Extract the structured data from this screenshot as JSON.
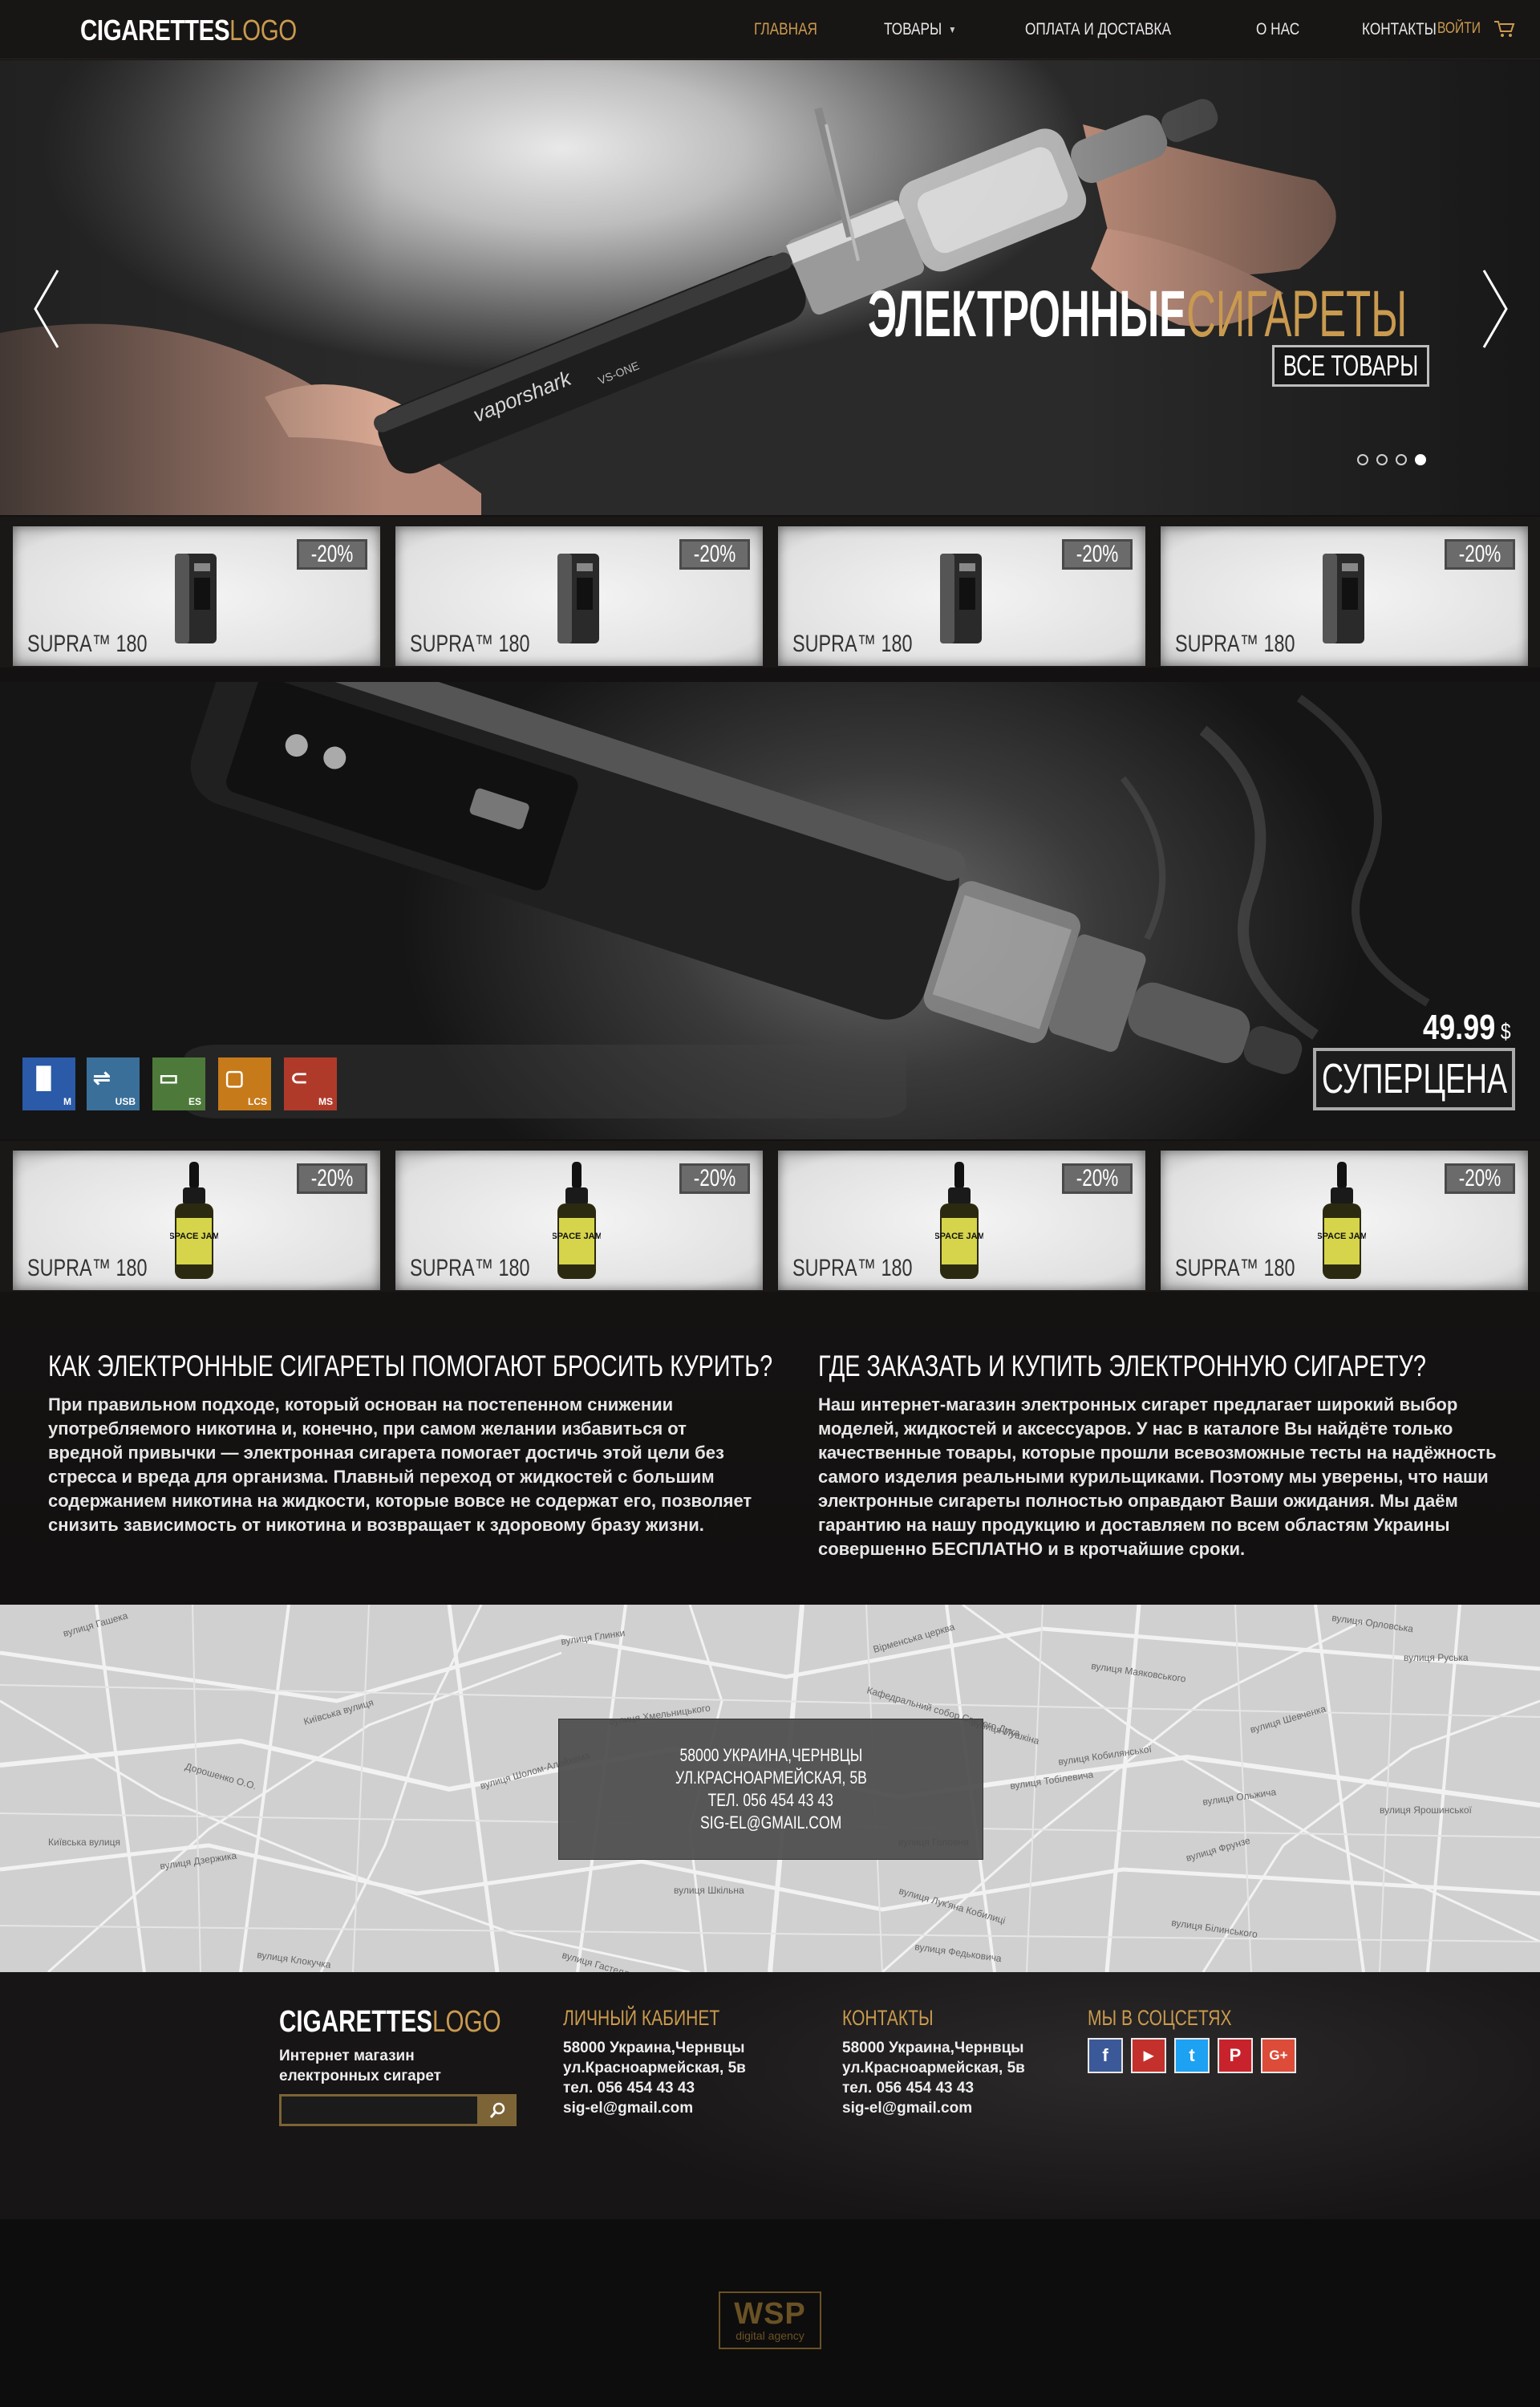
{
  "logo": {
    "part1": "CIGARETTES",
    "part2": "LOGO"
  },
  "nav": {
    "home": "ГЛАВНАЯ",
    "products": "ТОВАРЫ",
    "payment": "ОПЛАТА И ДОСТАВКА",
    "about": "О НАС",
    "contacts": "КОНТАКТЫ"
  },
  "cart": {
    "label": "ВОЙТИ",
    "icon": "cart-icon"
  },
  "hero": {
    "title_part1": "ЭЛЕКТРОННЫЕ",
    "title_part2": "СИГАРЕТЫ",
    "button": "ВСЕ ТОВАРЫ",
    "slides_total": 4,
    "active_slide": 4,
    "device_text": "vaporshark VS-ONE"
  },
  "products_row1": [
    {
      "name": "SUPRA™ 180",
      "badge": "-20%"
    },
    {
      "name": "SUPRA™ 180",
      "badge": "-20%"
    },
    {
      "name": "SUPRA™ 180",
      "badge": "-20%"
    },
    {
      "name": "SUPRA™ 180",
      "badge": "-20%"
    }
  ],
  "promo": {
    "price": "49.99",
    "currency": "$",
    "button": "СУПЕРЦЕНА",
    "features": [
      {
        "label": "M",
        "color": "#2a5aa8"
      },
      {
        "label": "USB",
        "color": "#3a6f9a"
      },
      {
        "label": "ES",
        "color": "#4d7a3a"
      },
      {
        "label": "LCS",
        "color": "#c77a1a"
      },
      {
        "label": "MS",
        "color": "#b03a2a"
      }
    ]
  },
  "products_row2": [
    {
      "name": "SUPRA™ 180",
      "badge": "-20%",
      "label": "SPACE JAM"
    },
    {
      "name": "SUPRA™ 180",
      "badge": "-20%",
      "label": "SPACE JAM"
    },
    {
      "name": "SUPRA™ 180",
      "badge": "-20%",
      "label": "SPACE JAM"
    },
    {
      "name": "SUPRA™ 180",
      "badge": "-20%",
      "label": "SPACE JAM"
    }
  ],
  "info": {
    "left": {
      "title": "КАК ЭЛЕКТРОННЫЕ СИГАРЕТЫ ПОМОГАЮТ БРОСИТЬ КУРИТЬ?",
      "text": "При правильном подходе, который основан на постепенном снижении употребляемого никотина и, конечно, при самом желании избавиться от вредной привычки — электронная сигарета помогает достичь этой цели без стресса и вреда для организма.     Плавный переход от жидкостей с большим содержанием никотина на жидкости, которые вовсе не содержат его, позволяет снизить зависимость от никотина и возвращает к здоровому бразу жизни."
    },
    "right": {
      "title": "ГДЕ ЗАКАЗАТЬ И КУПИТЬ ЭЛЕКТРОННУЮ СИГАРЕТУ?",
      "text": "Наш интернет-магазин электронных сигарет предлагает широкий выбор моделей, жидкостей и аксессуаров. У нас в каталоге Вы найдёте только качественные товары, которые прошли всевозможные тесты на надёжность самого изделия реальными курильщиками. Поэтому мы уверены, что наши электронные сигареты полностью оправдают Ваши ожидания. Мы даём гарантию на нашу продукцию и доставляем по всем областям Украины совершенно БЕСПЛАТНО и в кротчайшие сроки."
    }
  },
  "map": {
    "address1": "58000 УКРАИНА,ЧЕРНВЦЫ",
    "address2": "УЛ.КРАСНОАРМЕЙСКАЯ, 5В",
    "phone": "ТЕЛ. 056 454 43 43",
    "email": "SIG-EL@GMAIL.COM",
    "street_labels": [
      "вулиця Гашека",
      "вулиця Глинки",
      "вулиця Руська",
      "вулиця Орловська",
      "Кафедральний собор Святого Духа",
      "вулиця Шевченка",
      "вулиця Кобилянської",
      "вулиця Головна",
      "вулиця Федьковича",
      "Дорошенко О.О.",
      "Київська вулиця",
      "вулиця Дзержика",
      "вулиця Шкільна",
      "вулиця Маяковського",
      "вулиця Лук'яна Кобилиці",
      "вулиця Фрунзе",
      "вулиця Тобілевича",
      "вулиця Ярошинської",
      "вулиця Білинського",
      "вулиця Гастелло",
      "вулиця Шолом-Алейхема",
      "вулиця Хмельницького",
      "Київська вулиця",
      "вулиця Клокучка",
      "вулиця Пушкіна",
      "Вірменська церква",
      "вулиця Ольжича"
    ]
  },
  "footer": {
    "desc1": "Интернет магазин",
    "desc2": "електронных сигарет",
    "cabinet_title": "ЛИЧНЫЙ КАБИНЕТ",
    "cabinet_lines": [
      "58000 Украина,Чернвцы",
      "ул.Красноармейская, 5в",
      "тел. 056 454 43 43",
      "sig-el@gmail.com"
    ],
    "contacts_title": "КОНТАКТЫ",
    "contacts_lines": [
      "58000 Украина,Чернвцы",
      "ул.Красноармейская, 5в",
      "тел. 056 454 43 43",
      "sig-el@gmail.com"
    ],
    "social_title": "МЫ В СОЦСЕТЯХ",
    "socials": [
      {
        "name": "facebook-icon",
        "glyph": "f",
        "color": "#3b5998"
      },
      {
        "name": "youtube-icon",
        "glyph": "▶",
        "color": "#c4302b"
      },
      {
        "name": "twitter-icon",
        "glyph": "t",
        "color": "#1da1f2"
      },
      {
        "name": "pinterest-icon",
        "glyph": "P",
        "color": "#c8232c"
      },
      {
        "name": "google-plus-icon",
        "glyph": "G+",
        "color": "#dd4b39"
      }
    ]
  },
  "bottom": {
    "brand": "WSP",
    "tag": "digital agency"
  },
  "colors": {
    "accent": "#c99a4f",
    "dark": "#131111"
  }
}
